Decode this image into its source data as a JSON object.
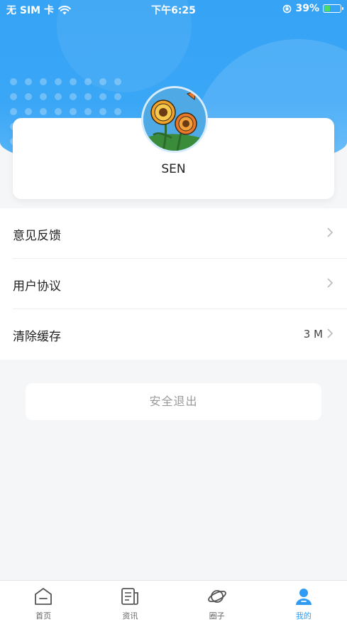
{
  "status_bar": {
    "carrier": "无 SIM 卡",
    "time": "下午6:25",
    "battery_percent": "39%",
    "battery_level": 0.39,
    "wifi_icon": "wifi-icon",
    "orientation_lock_icon": "orientation-lock-icon"
  },
  "profile": {
    "username": "SEN",
    "avatar_icon": "flower-avatar"
  },
  "menu": {
    "items": [
      {
        "label": "意见反馈",
        "value": ""
      },
      {
        "label": "用户协议",
        "value": ""
      },
      {
        "label": "清除缓存",
        "value": "3 M"
      }
    ]
  },
  "logout": {
    "label": "安全退出"
  },
  "tabbar": {
    "tabs": [
      {
        "label": "首页",
        "icon": "home-icon",
        "active": false
      },
      {
        "label": "资讯",
        "icon": "news-icon",
        "active": false
      },
      {
        "label": "圈子",
        "icon": "planet-icon",
        "active": false
      },
      {
        "label": "我的",
        "icon": "user-icon",
        "active": true
      }
    ]
  },
  "colors": {
    "accent": "#2f9bf3",
    "header_blue": "#36a3f5",
    "background": "#f5f6f8"
  }
}
